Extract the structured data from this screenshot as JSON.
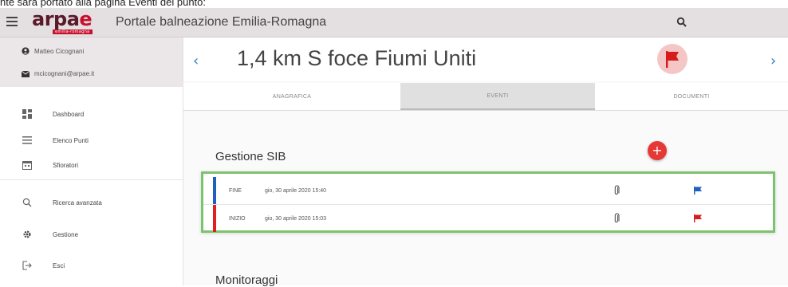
{
  "caption": "nte sarà portato alla pagina Eventi del punto:",
  "header": {
    "logo_main": "arpa",
    "logo_e": "e",
    "logo_tag": "emilia-romagna",
    "title": "Portale balneazione Emilia-Romagna"
  },
  "user": {
    "name": "Matteo Cicognani",
    "email": "mcicognani@arpae.it"
  },
  "sidebar": {
    "items": [
      {
        "label": "Dashboard",
        "icon": "dashboard-icon"
      },
      {
        "label": "Elenco Punti",
        "icon": "list-icon"
      },
      {
        "label": "Sfioratori",
        "icon": "calendar-icon"
      },
      {
        "label": "Ricerca avanzata",
        "icon": "search-icon"
      },
      {
        "label": "Gestione",
        "icon": "gear-icon"
      },
      {
        "label": "Esci",
        "icon": "logout-icon"
      }
    ]
  },
  "point": {
    "title": "1,4 km S foce Fiumi Uniti",
    "prev": "‹",
    "next": "›"
  },
  "tabs": [
    "ANAGRAFICA",
    "EVENTI",
    "DOCUMENTI"
  ],
  "section": {
    "title": "Gestione SIB",
    "add": "+"
  },
  "events": [
    {
      "type": "FINE",
      "date": "gio, 30 aprile 2020 15:40",
      "color": "#1e5fbf"
    },
    {
      "type": "INIZIO",
      "date": "gio, 30 aprile 2020 15:03",
      "color": "#e02020"
    }
  ],
  "section2": {
    "title": "Monitoraggi"
  },
  "colors": {
    "accent_red": "#e53935",
    "accent_blue": "#2a7cc0",
    "highlight_green": "#7cc46b"
  }
}
